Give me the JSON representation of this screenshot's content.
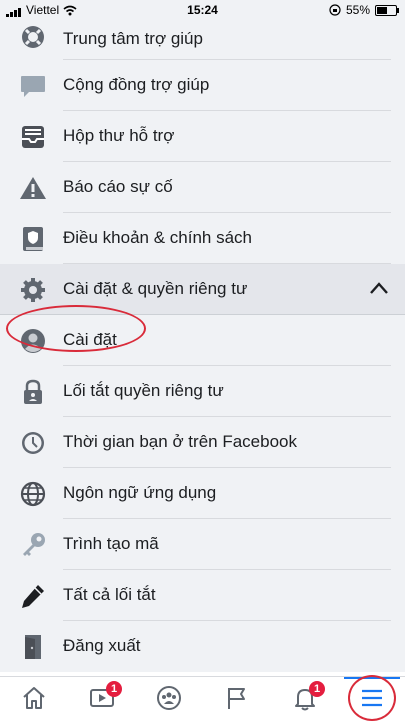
{
  "status_bar": {
    "carrier": "Viettel",
    "time": "15:24",
    "battery_percent": "55%",
    "battery_level": 0.55
  },
  "menu": {
    "items": [
      {
        "label": "Trung tâm trợ giúp",
        "icon": "lifebuoy-icon"
      },
      {
        "label": "Cộng đồng trợ giúp",
        "icon": "speech-bubble-icon"
      },
      {
        "label": "Hộp thư hỗ trợ",
        "icon": "inbox-icon"
      },
      {
        "label": "Báo cáo sự cố",
        "icon": "warning-icon"
      },
      {
        "label": "Điều khoản & chính sách",
        "icon": "policy-book-icon"
      }
    ],
    "section": {
      "label": "Cài đặt & quyền riêng tư",
      "icon": "gear-icon",
      "expanded": true
    },
    "sub_items": [
      {
        "label": "Cài đặt",
        "icon": "account-icon",
        "highlighted": true
      },
      {
        "label": "Lối tắt quyền riêng tư",
        "icon": "privacy-lock-icon"
      },
      {
        "label": "Thời gian bạn ở trên Facebook",
        "icon": "clock-icon"
      },
      {
        "label": "Ngôn ngữ ứng dụng",
        "icon": "globe-icon"
      },
      {
        "label": "Trình tạo mã",
        "icon": "key-icon"
      },
      {
        "label": "Tất cả lối tắt",
        "icon": "pencil-icon"
      },
      {
        "label": "Đăng xuất",
        "icon": "logout-door-icon"
      }
    ]
  },
  "tabbar": {
    "tabs": [
      {
        "name": "home",
        "icon": "home-icon",
        "badge": ""
      },
      {
        "name": "watch",
        "icon": "video-icon",
        "badge": "1"
      },
      {
        "name": "groups",
        "icon": "groups-icon",
        "badge": ""
      },
      {
        "name": "pages",
        "icon": "flag-icon",
        "badge": ""
      },
      {
        "name": "notifications",
        "icon": "bell-icon",
        "badge": "1"
      },
      {
        "name": "menu",
        "icon": "hamburger-menu-icon",
        "badge": "",
        "active": true
      }
    ]
  },
  "colors": {
    "row_bg": "#f0f2f5",
    "section_bg": "#e4e6eb",
    "accent": "#1877f2",
    "badge": "#e41e3f",
    "annotation": "#d92b3a",
    "icon_gray": "#606770"
  }
}
